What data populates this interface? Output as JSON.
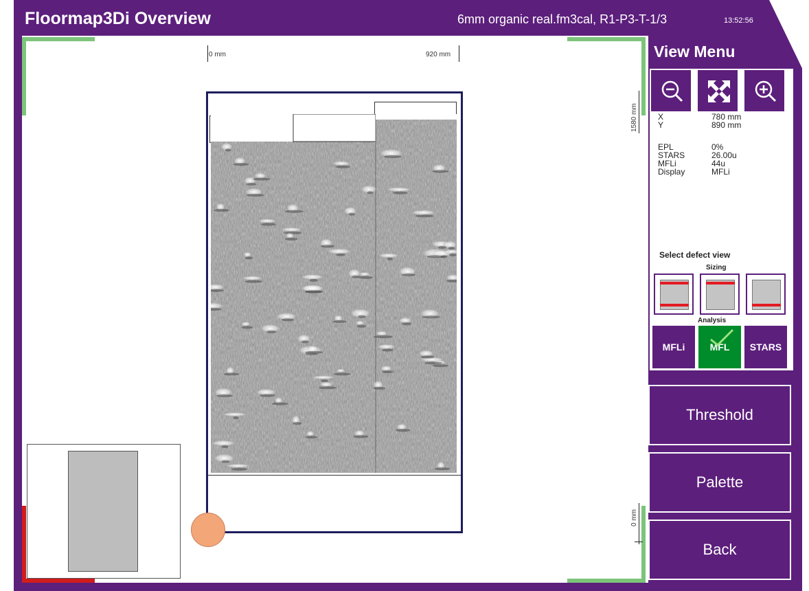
{
  "header": {
    "title": "Floormap3Di Overview",
    "file_info": "6mm organic real.fm3cal, R1-P3-T-1/3",
    "time": "13:52:56"
  },
  "map": {
    "ruler_top_start": "0 mm",
    "ruler_top_end": "920 mm",
    "ruler_right_top": "1580 mm",
    "ruler_right_bottom": "0 mm"
  },
  "view_menu": {
    "title": "View Menu",
    "zoom_out_icon": "zoom-out-icon",
    "fit_icon": "fit-to-screen-icon",
    "zoom_in_icon": "zoom-in-icon"
  },
  "readout": {
    "x_label": "X",
    "x_value": "780 mm",
    "y_label": "Y",
    "y_value": "890 mm",
    "epl_label": "EPL",
    "epl_value": "0%",
    "stars_label": "STARS",
    "stars_value": "26.00u",
    "mfli_label": "MFLi",
    "mfli_value": "44u",
    "display_label": "Display",
    "display_value": "MFLi"
  },
  "defect_view": {
    "title": "Select defect view",
    "sizing_label": "Sizing",
    "analysis_label": "Analysis",
    "analysis_buttons": [
      "MFLi",
      "MFL",
      "STARS"
    ],
    "active_analysis": "MFL"
  },
  "actions": {
    "threshold": "Threshold",
    "palette": "Palette",
    "back": "Back"
  },
  "colors": {
    "frame": "#5c1f7c",
    "active": "#008c2a",
    "marker": "#e21b22",
    "corner_green": "#7cc47a",
    "corner_red": "#d11c1c"
  }
}
